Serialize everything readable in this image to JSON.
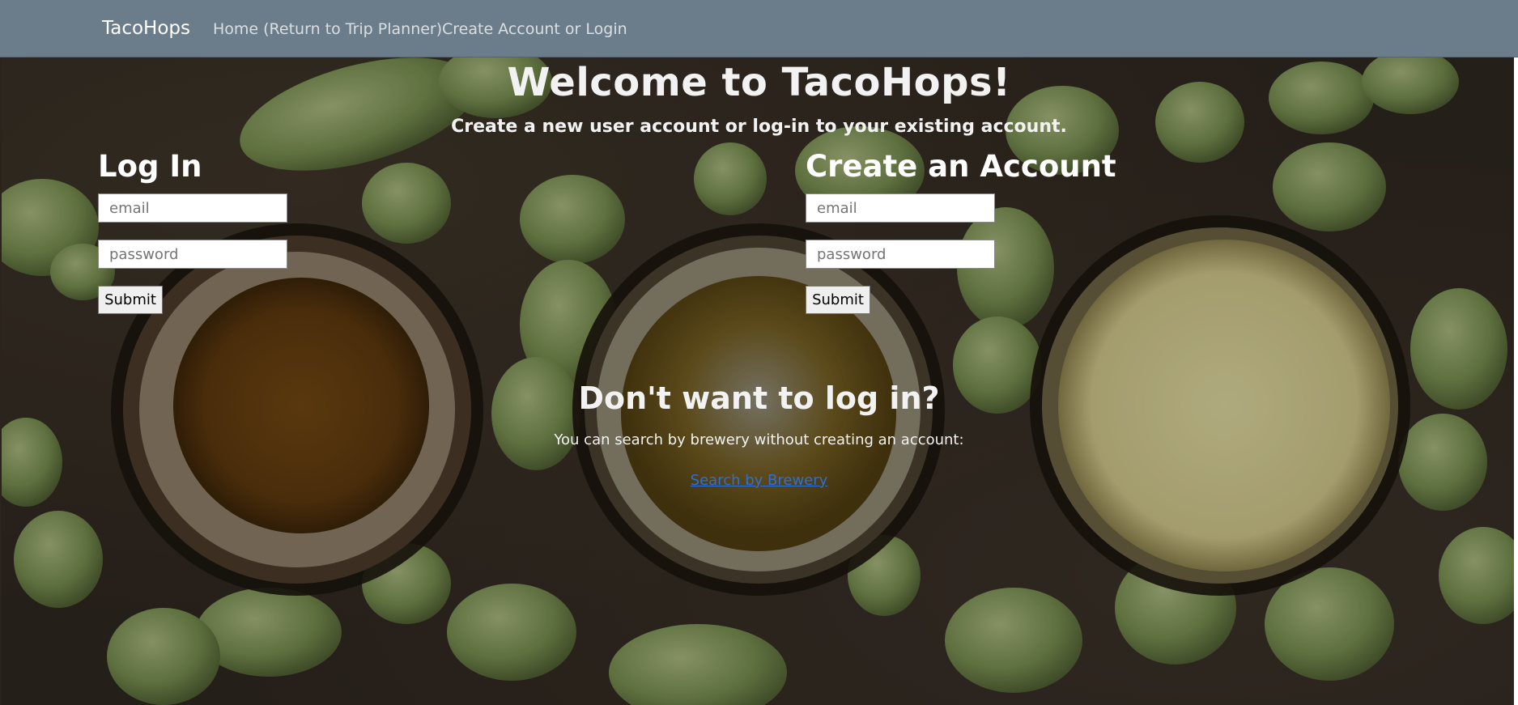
{
  "nav": {
    "brand": "TacoHops",
    "links": [
      {
        "label": "Home (Return to Trip Planner)"
      },
      {
        "label": "Create Account or Login"
      }
    ]
  },
  "hero": {
    "title": "Welcome to TacoHops!",
    "subtitle": "Create a new user account or log-in to your existing account."
  },
  "login": {
    "heading": "Log In",
    "email_placeholder": "email",
    "password_placeholder": "password",
    "submit_label": "Submit"
  },
  "create": {
    "heading": "Create an Account",
    "email_placeholder": "email",
    "password_placeholder": "password",
    "submit_label": "Submit"
  },
  "guest": {
    "heading": "Don't want to log in?",
    "text": "You can search by brewery without creating an account:",
    "link_label": "Search by Brewery"
  },
  "colors": {
    "navbar": "#6b7d8a",
    "link": "#2f6fd6",
    "background": "#2e261f"
  }
}
